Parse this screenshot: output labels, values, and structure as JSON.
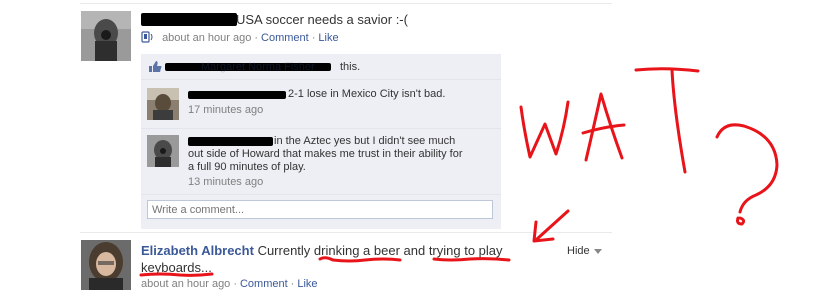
{
  "post1": {
    "text": "USA soccer needs a savior :-(",
    "time": "about an hour ago",
    "comment_label": "Comment",
    "like_label": "Like"
  },
  "likes": {
    "visible_names": "Margaret Norma Fisher",
    "suffix": "this."
  },
  "comments": [
    {
      "text": "2-1 lose in Mexico City isn't bad.",
      "time": "17 minutes ago"
    },
    {
      "text": "in the Aztec yes but I didn't see much out side of Howard that makes me trust in their ability for a full 90 minutes of play.",
      "time": "13 minutes ago"
    }
  ],
  "comment_box": {
    "placeholder": "Write a comment..."
  },
  "post2": {
    "author": "Elizabeth Albrecht",
    "text": "Currently drinking a beer and trying to play keyboards...",
    "text_line1": "Currently drinking a beer and trying to play",
    "text_line2": "keyboards...",
    "time": "about an hour ago",
    "comment_label": "Comment",
    "like_label": "Like",
    "hide_label": "Hide"
  },
  "annotation": {
    "text": "WAT?",
    "color": "#e8141a"
  },
  "colors": {
    "link": "#3b5998",
    "comment_bg": "#edeff4",
    "annotation": "#e8141a"
  }
}
